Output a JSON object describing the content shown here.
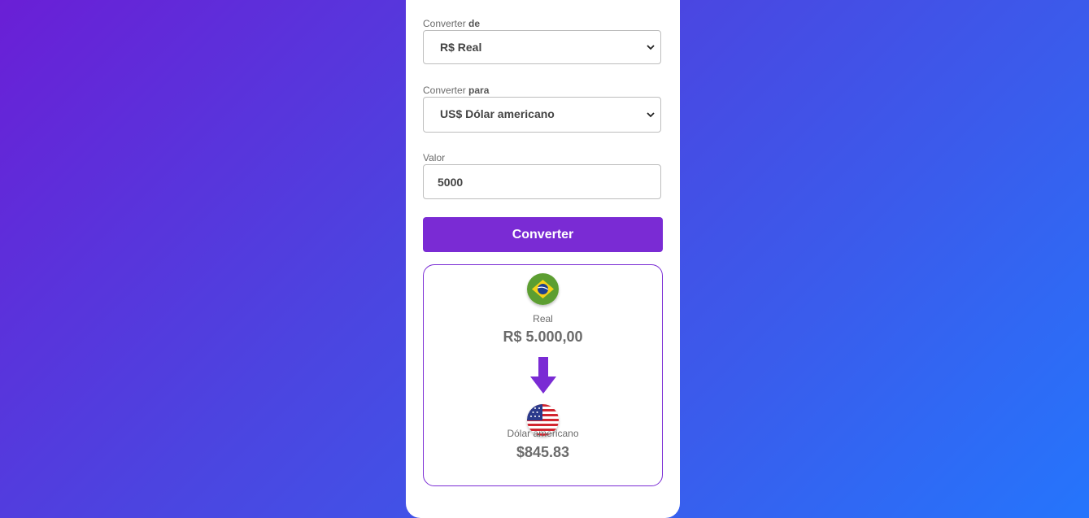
{
  "form": {
    "from_label_prefix": "Converter",
    "from_label_bold": "de",
    "from_value": "R$ Real",
    "to_label_prefix": "Converter",
    "to_label_bold": "para",
    "to_value": "US$ Dólar americano",
    "amount_label": "Valor",
    "amount_value": "5000",
    "convert_button": "Converter"
  },
  "result": {
    "from_name": "Real",
    "from_amount": "R$ 5.000,00",
    "from_icon": "brazil-flag-icon",
    "to_name": "Dólar americano",
    "to_amount": "$845.83",
    "to_icon": "usa-flag-icon"
  },
  "colors": {
    "accent": "#7a2bd4",
    "gradient_start": "#6a1fd6",
    "gradient_end": "#2575fc"
  }
}
